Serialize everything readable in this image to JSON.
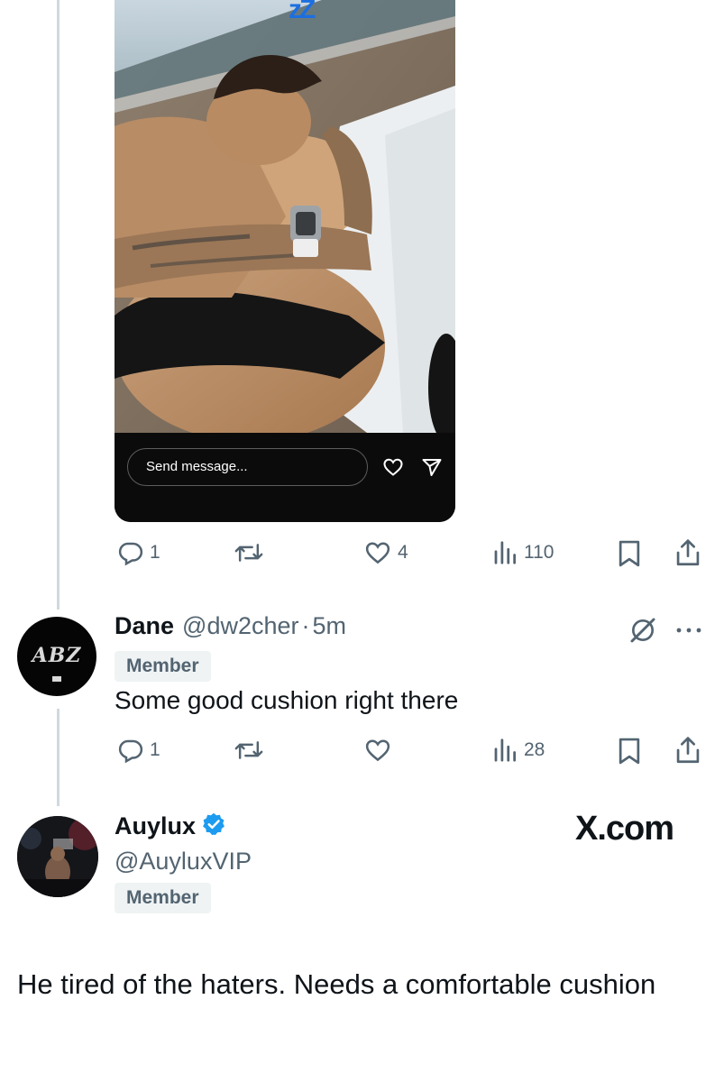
{
  "story": {
    "send_placeholder": "Send message...",
    "sleep_glyph": "zZ"
  },
  "post_actions": {
    "replies": "1",
    "reposts": "",
    "likes": "4",
    "views": "110"
  },
  "reply": {
    "name": "Dane",
    "handle": "@dw2cher",
    "separator": "·",
    "time": "5m",
    "badge": "Member",
    "text": "Some good cushion right there",
    "avatar_text": "ABZ",
    "actions": {
      "replies": "1",
      "reposts": "",
      "likes": "",
      "views": "28"
    }
  },
  "author": {
    "name": "Auylux",
    "handle": "@AuyluxVIP",
    "badge": "Member",
    "verified": true,
    "watermark": "X.com"
  },
  "caption": "He tired of the haters. Needs a comfortable cushion",
  "colors": {
    "verified": "#1d9bf0",
    "muted": "#536471",
    "text": "#0f1419",
    "badge_bg": "#eff3f4"
  },
  "icons": {
    "reply": "reply-icon",
    "repost": "repost-icon",
    "like": "heart-icon",
    "views": "views-icon",
    "bookmark": "bookmark-icon",
    "share": "share-icon",
    "grok": "grok-icon",
    "more": "more-icon"
  }
}
